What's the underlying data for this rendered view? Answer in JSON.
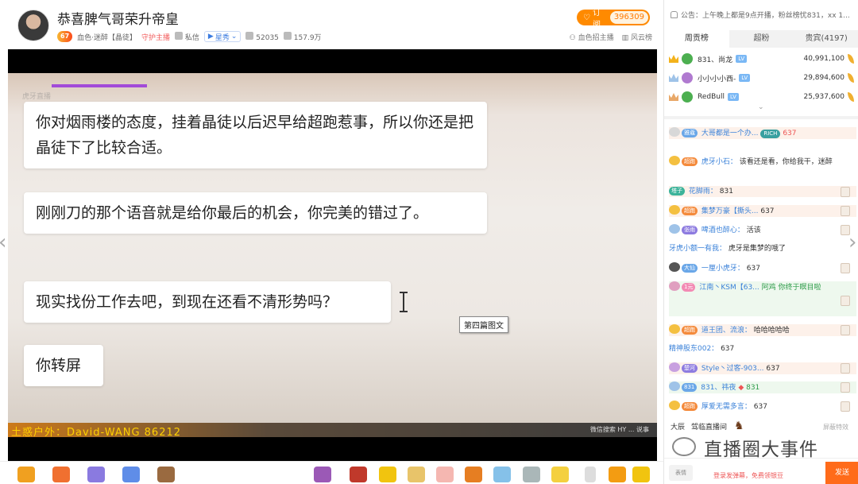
{
  "header": {
    "title": "恭喜脾气哥荣升帝皇",
    "level": "67",
    "category": "血色·迷醉【晶徒】",
    "guard": "守护主播",
    "message": "私信",
    "star": "星秀",
    "views": "52035",
    "heat": "157.9万",
    "recruit": "血色招主播",
    "wind_list": "风云榜",
    "subscribe_label": "订阅",
    "subscribe_count": "396309"
  },
  "video": {
    "watermark": "虎牙直播",
    "bubbles": [
      "你对烟雨楼的态度，挂着晶徒以后迟早给超跑惹事，所以你还是把晶徒下了比较合适。",
      "刚刚刀的那个语音就是给你最后的机会，你完美的错过了。",
      "现实找份工作去吧，到现在还看不清形势吗？",
      "你转屏"
    ],
    "tooltip": "第四篇图文",
    "banner": "土惑户外：David-WANG  86212",
    "banner_right": "微信搜索 HY ... 说事"
  },
  "sidebar": {
    "notice": "公告：上午晚上都是9点开播，粉丝榜忧831，xx 1...",
    "tabs": [
      "周贡榜",
      "超粉",
      "贵宾(4197)"
    ],
    "ranks": [
      {
        "name": "831、尚龙",
        "tag": "LV",
        "score": "40,991,100"
      },
      {
        "name": "小小小小西-",
        "tag": "LV",
        "score": "29,894,600"
      },
      {
        "name": "RedBull",
        "tag": "LV",
        "score": "25,937,600"
      }
    ],
    "chat": [
      {
        "tag": "雅蔻",
        "user": "大哥都是一个办...",
        "extra": "RICH",
        "text": "637"
      },
      {
        "tag": "超跑",
        "user": "虎牙小石：",
        "text": "该看还是看，你给我干，迷醉"
      },
      {
        "tag": "塔子",
        "user": "花脚雨：",
        "text": "831"
      },
      {
        "tag": "超跑",
        "user": "集梦万豪【撕头...",
        "text": "637"
      },
      {
        "tag": "张雨",
        "user": "啤酒也醉心：",
        "text": "活该"
      },
      {
        "tag": "",
        "user": "牙虎小额一有我：",
        "text": "虎牙是集梦的哦了"
      },
      {
        "tag": "大仙",
        "user": "一厘小虎牙：",
        "text": "637"
      },
      {
        "tag": "1元",
        "user": "江南丶KSM【63...",
        "text": "阿鸡 你终于瞑目啦"
      },
      {
        "tag": "超跑",
        "user": "道王团、流浪：",
        "text": "哈哈哈哈哈"
      },
      {
        "tag": "",
        "user": "精神股东002：",
        "text": "637"
      },
      {
        "tag": "楚河",
        "user": "Style丶过客-903...",
        "text": "637"
      },
      {
        "tag": "831",
        "user": "831、祎夜",
        "text": "831"
      },
      {
        "tag": "超跑",
        "user": "厚爱无需多言：",
        "text": "637"
      }
    ],
    "enter_user": "大辰",
    "enter_text": "驾临直播间",
    "effect_label": "屏蔽特效",
    "emoji_label": "表情",
    "login_tip": "登录发弹幕，免费领银豆",
    "send_label": "发送"
  },
  "brand_watermark": "直播圈大事件"
}
